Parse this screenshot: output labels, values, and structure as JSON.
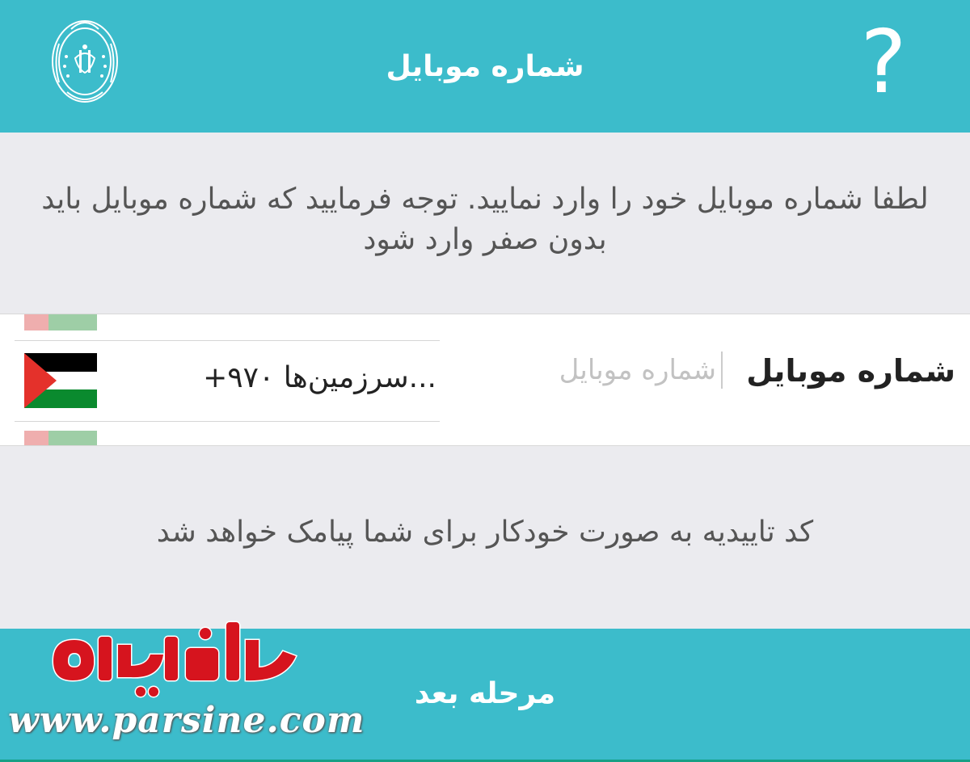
{
  "header": {
    "title": "شماره موبایل",
    "help_label": "?",
    "logo_icon": "bank-emblem-icon",
    "background": "#3cbccb"
  },
  "instruction": {
    "text": "لطفا شماره موبایل خود را وارد نمایید. توجه فرمایید که شماره موبایل باید بدون صفر وارد شود"
  },
  "phone_row": {
    "label": "شماره موبایل",
    "input_placeholder": "شماره موبایل",
    "input_value": "",
    "country_picker": {
      "selected": "+۹۷۰ سرزمین‌ها...",
      "flag_icon": "palestine-flag-icon"
    }
  },
  "sms_note": "کد تاییدیه به صورت خودکار برای شما پیامک خواهد شد",
  "footer": {
    "next_label": "مرحله بعد"
  },
  "watermark": {
    "logo_text": "پارسینه",
    "url": "www.parsine.com"
  }
}
